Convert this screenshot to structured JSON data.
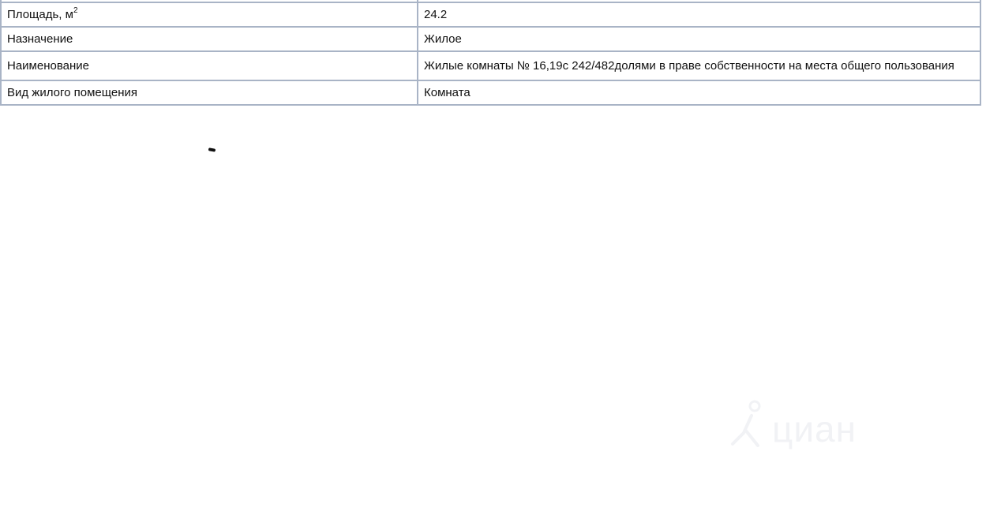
{
  "table": {
    "rows": [
      {
        "label": "Площадь, м",
        "label_sup": "2",
        "value": "24.2"
      },
      {
        "label": "Назначение",
        "value": "Жилое"
      },
      {
        "label": "Наименование",
        "value": "Жилые комнаты № 16,19с 242/482долями в праве собственности на места общего пользования"
      },
      {
        "label": "Вид жилого помещения",
        "value": "Комната"
      }
    ]
  },
  "watermark": {
    "text": "циан"
  },
  "colors": {
    "border": "#a9b4c6",
    "text": "#111111",
    "watermark": "#f1f2f5"
  }
}
